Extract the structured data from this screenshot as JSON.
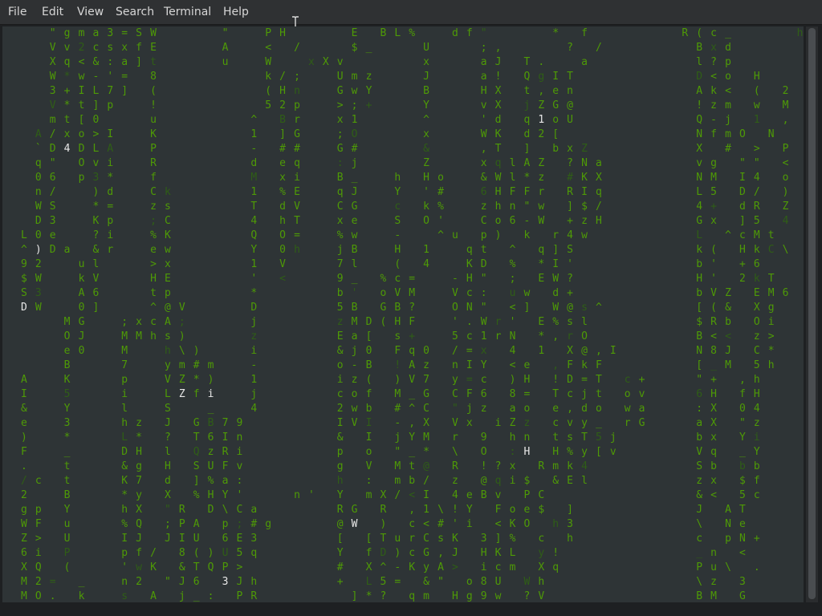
{
  "colors": {
    "terminal_bg": "#2e3436",
    "rain_bright": "#4e9a06",
    "rain_dim": "#2f5e16",
    "highlight": "#e8e8e8"
  },
  "menu": [
    {
      "label": "File"
    },
    {
      "label": "Edit"
    },
    {
      "label": "View"
    },
    {
      "label": "Search"
    },
    {
      "label": "Terminal"
    },
    {
      "label": "Help"
    }
  ],
  "terminal": {
    "rows": [
      "   \"gma3=SW    \"  PH    E BL%  df\"    * f      R(c_    h    > wT Y$",
      "   Vv2csxfE    A  < /   $_   U   ;,    ? /      Bxd          \" tN 3[",
      "   Xq<&:a]t    u  W  xXv     x   aJ T.  a       l?p          ; nH 4.",
      "   W*w-'= 8       k/;  Umz   J   a! QgIT        D<o H        c X2 OG",
      "   3+IL7] (       (Hn  GwY   B   HX t,en        Ak< ( 2      _ D_ Q&",
      "   V*t]p  !       52p  >;+   Y   vX jZG@        !zm w M      S U\" AF",
      "   mt[0   u      ^ Br  x1    ^   'd q1oU        Q-j 1 ,      y dw [6",
      "  A/xo>I  K      1 ]G  ;O    x   WK d2[         NfmO N       c j: F>",
      "  `D4DLA  P      - ##  G#    &   ,T ] bxZ       X # > P      / Aq GB",
      "  q\" Ovi  R      d eq  :j    Z   xqlAZ ?Na      vg \"\" <      ! E x 4&",
      "  06 p3*  f      M xi  B_  h Ho  &Wl*z #KX      NM I4 o      q 9 /R",
      "  n/  )d  Ck     1 %E  qJ  Y '#  6HFFr RIq      L5 D/ )    \\ 5 9 hJ",
      "  WS  *=  zs     T dV  CG  c k%  zhn\"w ]$/      4+ dR Z    !   m hU",
      "  D3  Kp  ;C     4 hT  xe  S O'  Co6-W +zH      Gx ]5 4    j   f \\.",
      " L0e  ?i  %K     Q O=  %w  -  ^u p) k r4w       L ^cMt    4 + D  0=",
      " ^)Da &r  ew     Y 0h  jB  H 1  qt ^ q]S        k( HkC\\   L P m  g",
      " 92  ul   >x     1 V   7l  ( 4  KD % *I'        b' +6    6 9 r i",
      " $W  kV   HE     ' <   9_ %c=  -H\" ; EW?        H' 2kT   v b RJ",
      " S3  A6   tp     *     b' oVM  Vc: uw d+        bVZ EM6  k\\d $e",
      " DW  0]   ^@V    D     5B GB?  ON\" <] W@s^      [(& Xg   ;R5 $",
      "    MG  ;xcA;    j     zMD(HF  '.Wr' E%sl       $Rb Oi   ;\\w- -",
      "    OJ  MMhs)    z     Ea[ s+  5c1rN *,rO       B<< z>   Mm@3 K ;",
      "    e0  M  h\\)   i     &j0 Fq0 /=x 4 1 X@,I     N8J C*   Ha!J > 5",
      "    B   7  ym#m  -     o-B !Az nIY <e ,FkF      [_M 5h   =Lr_ m r",
      " A  K   p  VZ*)  1     iz( )V7 y=c )H !D=T c+   \"+ ,h    LNuj - (",
      " I  5   i  LZfi  j     cof M_G CF6 8= Tcjt ov   6H fH    XyVy $ 7",
      " &  Y   l  S  _  4     2wb #^C \"jz ao e,do wa   :X 04    >%.) b 4",
      " e  3   hz J GB79      IVI -,X Vx iZz cvy_ rG   aX \"z    D-KK r",
      " )  *   L* ? T6In      & I jYM r 9 hn tsT5j     bx Yi    7jk@ o w",
      " F  _   DH l QzRi      p o \"_* \\ O :H H%y[v     Vq _Y    :x\"_ ! z",
      " .  t   &g H SUFv      g V Mt@ R !?x Rmk4       Sb bb    r\")Z / D\"",
      " /c t   K7 d ]%a:      h : mb/ z @qi$ &El       zx $f    7@bB ( 5bW",
      " 2  B   *y X %HY'   n' Y mX/<I 4eBv PC          &< 5c    5!TY c e(%",
      " gp Y   hX \"R D\\Ca     RG R ,1\\!Y Foe$ ]        J AT    <D&W 3 h(e",
      " WF u   %Q ;PA p;#g    @W ) c<#'i <KO h3        \\ Ne    '5G , 7%V",
      " Z> U   IJ JIU 6E3     [ [TurCsK 3]% c h        c pN+   ?@k ' ? m",
      " 6i P   pf/ 8()U5q     Y fD)cG,J HKL y!         _n <    ? ! P ]",
      " XQ (   'wK &TQP>      # X^-KyA> icm Xq         Pu\\ .   . V =",
      " M2= _  n2 \"J6 3Jh     + L5= &\" o8U Wh          \\z 3    = i 3",
      " MO. k  s A j_: PR      ]*? qm Hg9w ?V          BM G     m ! m"
    ],
    "bright": [
      [
        0,
        62,
        "h"
      ],
      [
        0,
        43,
        "B"
      ],
      [
        0,
        44,
        "L"
      ],
      [
        0,
        51,
        "d"
      ],
      [
        2,
        16,
        "u"
      ],
      [
        5,
        16,
        "5"
      ],
      [
        5,
        20,
        "+"
      ],
      [
        6,
        37,
        "1"
      ],
      [
        7,
        47,
        "f"
      ],
      [
        8,
        4,
        "4"
      ],
      [
        9,
        69,
        "x"
      ],
      [
        10,
        6,
        "p"
      ],
      [
        11,
        69,
        "5"
      ],
      [
        13,
        36,
        "6"
      ],
      [
        13,
        38,
        "W"
      ],
      [
        14,
        35,
        "u"
      ],
      [
        14,
        73,
        "0"
      ],
      [
        15,
        2,
        ")"
      ],
      [
        15,
        57,
        "H"
      ],
      [
        15,
        78,
        "g"
      ],
      [
        17,
        15,
        "<"
      ],
      [
        18,
        59,
        "6"
      ],
      [
        18,
        71,
        "e"
      ],
      [
        19,
        1,
        "D"
      ],
      [
        19,
        4,
        "W"
      ],
      [
        19,
        28,
        "("
      ],
      [
        20,
        7,
        "G"
      ],
      [
        20,
        10,
        "x"
      ],
      [
        21,
        10,
        "M"
      ],
      [
        21,
        63,
        "Z"
      ],
      [
        22,
        7,
        "0"
      ],
      [
        25,
        12,
        "Z"
      ],
      [
        25,
        14,
        "i"
      ],
      [
        27,
        20,
        "I"
      ],
      [
        27,
        35,
        "i"
      ],
      [
        27,
        53,
        "G"
      ],
      [
        29,
        36,
        "H"
      ],
      [
        29,
        56,
        "q"
      ],
      [
        30,
        6,
        "$"
      ],
      [
        31,
        47,
        "E"
      ],
      [
        33,
        46,
        "F"
      ],
      [
        33,
        60,
        "<"
      ],
      [
        34,
        24,
        "W"
      ],
      [
        34,
        57,
        "\\"
      ],
      [
        35,
        67,
        "k"
      ],
      [
        35,
        69,
        "'"
      ],
      [
        36,
        19,
        "q"
      ],
      [
        37,
        8,
        "K"
      ],
      [
        37,
        33,
        "K"
      ],
      [
        37,
        34,
        "y"
      ],
      [
        37,
        68,
        "."
      ],
      [
        38,
        15,
        "3"
      ],
      [
        38,
        26,
        "+"
      ]
    ]
  }
}
